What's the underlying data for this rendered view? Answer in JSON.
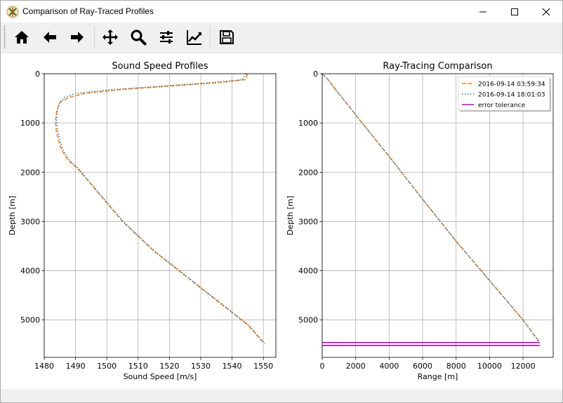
{
  "window": {
    "title": "Comparison of Ray-Traced Profiles"
  },
  "toolbar": {
    "buttons": [
      "home-icon",
      "back-icon",
      "forward-icon",
      "pan-icon",
      "zoom-icon",
      "configure-subplots-icon",
      "edit-axis-icon",
      "save-icon"
    ]
  },
  "colors": {
    "series_a": "#ff7f0e",
    "series_b": "#1f77b4",
    "tolerance": "#bf00bf",
    "grid": "#b0b0b0"
  },
  "chart_data": [
    {
      "type": "line",
      "title": "Sound Speed Profiles",
      "xlabel": "Sound Speed [m/s]",
      "ylabel": "Depth [m]",
      "xlim": [
        1480,
        1554
      ],
      "ylim": [
        5760,
        0
      ],
      "y_inverted": true,
      "grid": true,
      "xticks": [
        1480,
        1490,
        1500,
        1510,
        1520,
        1530,
        1540,
        1550
      ],
      "yticks": [
        0,
        1000,
        2000,
        3000,
        4000,
        5000
      ],
      "series": [
        {
          "style": "dashed",
          "color": "#ff7f0e",
          "x": [
            1545.0,
            1544.3,
            1536.0,
            1520.5,
            1505.0,
            1493.0,
            1488.0,
            1485.0,
            1484.0,
            1483.6,
            1483.8,
            1484.5,
            1485.5,
            1487.5,
            1491.0,
            1497.0,
            1505.0,
            1515.0,
            1525.0,
            1535.0,
            1545.0,
            1550.3
          ],
          "y": [
            0,
            120,
            180,
            250,
            320,
            400,
            480,
            580,
            750,
            950,
            1150,
            1350,
            1550,
            1750,
            1950,
            2400,
            3000,
            3600,
            4100,
            4600,
            5100,
            5480
          ]
        },
        {
          "style": "dotted",
          "color": "#1f77b4",
          "x": [
            1544.5,
            1543.3,
            1533.5,
            1518.0,
            1502.0,
            1490.0,
            1486.5,
            1485.0,
            1484.2,
            1483.9,
            1484.3,
            1485.0,
            1486.0,
            1488.0,
            1491.3,
            1497.2,
            1505.2,
            1515.2,
            1525.2,
            1535.2,
            1545.2,
            1550.5
          ],
          "y": [
            0,
            120,
            180,
            250,
            320,
            400,
            480,
            580,
            750,
            950,
            1150,
            1350,
            1550,
            1750,
            1950,
            2400,
            3000,
            3600,
            4100,
            4600,
            5100,
            5480
          ]
        }
      ]
    },
    {
      "type": "line",
      "title": "Ray-Tracing Comparison",
      "xlabel": "Range [m]",
      "ylabel": "Depth [m]",
      "xlim": [
        0,
        13800
      ],
      "ylim": [
        5760,
        0
      ],
      "y_inverted": true,
      "grid": true,
      "xticks": [
        0,
        2000,
        4000,
        6000,
        8000,
        10000,
        12000
      ],
      "yticks": [
        0,
        1000,
        2000,
        3000,
        4000,
        5000
      ],
      "legend_position": "top-right",
      "series": [
        {
          "name": "2016-09-14 03:59:34",
          "style": "dashed",
          "color": "#ff7f0e",
          "x": [
            0,
            300,
            800,
            1500,
            2500,
            4000,
            6000,
            8000,
            10000,
            12000,
            13000
          ],
          "y": [
            0,
            100,
            320,
            620,
            1050,
            1680,
            2550,
            3400,
            4200,
            5000,
            5460
          ]
        },
        {
          "name": "2016-09-14 18:01:03",
          "style": "dotted",
          "color": "#1f77b4",
          "x": [
            0,
            300,
            800,
            1500,
            2500,
            4000,
            6000,
            8000,
            10000,
            12000,
            12950
          ],
          "y": [
            0,
            100,
            320,
            620,
            1050,
            1680,
            2550,
            3400,
            4200,
            5000,
            5440
          ]
        },
        {
          "name": "error tolerance",
          "style": "solid",
          "color": "#bf00bf",
          "x": [
            0,
            13000
          ],
          "y_lines": [
            5460,
            5520
          ]
        }
      ]
    }
  ]
}
